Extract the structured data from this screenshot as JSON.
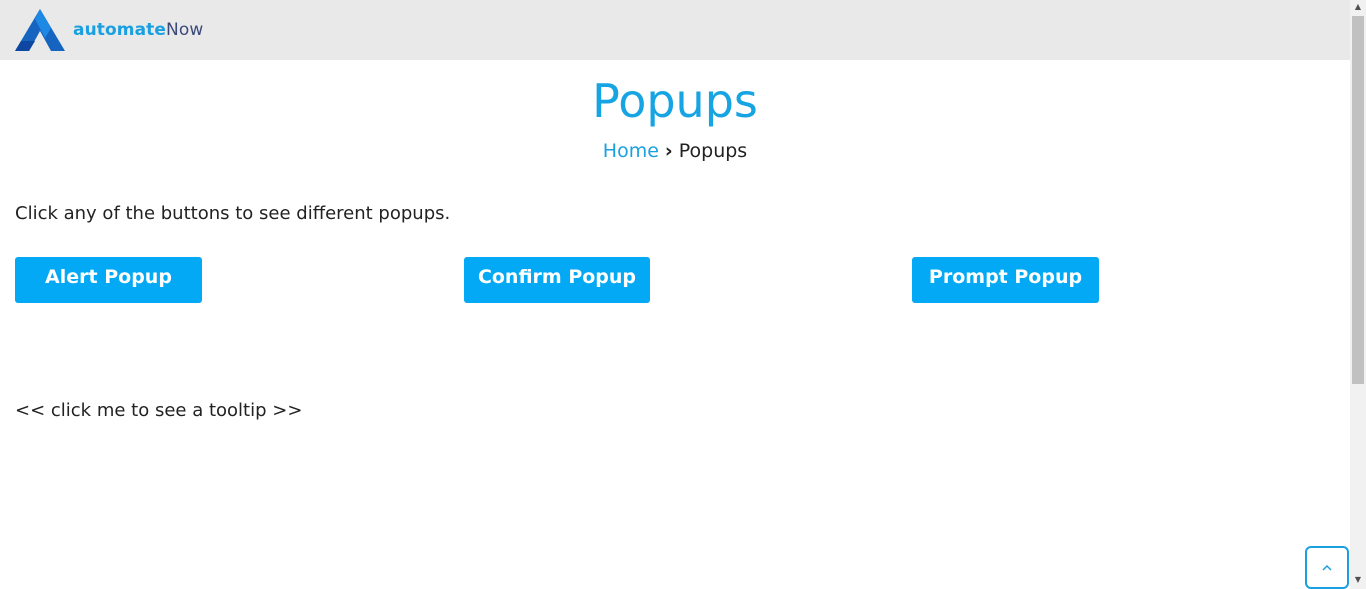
{
  "header": {
    "logo_text_part1": "automate",
    "logo_text_part2": "Now"
  },
  "page": {
    "title": "Popups",
    "breadcrumb": {
      "home": "Home",
      "separator": "›",
      "current": "Popups"
    },
    "intro": "Click any of the buttons to see different popups.",
    "buttons": {
      "alert": "Alert Popup",
      "confirm": "Confirm Popup",
      "prompt": "Prompt Popup"
    },
    "tooltip_link": "<< click me to see a tooltip >>"
  },
  "icons": {
    "logo": "automatenow-logo-icon",
    "scroll_top": "chevron-up-icon"
  },
  "colors": {
    "accent": "#03a9f4",
    "title": "#16a4e2",
    "header_bg": "#e9e9e9"
  }
}
